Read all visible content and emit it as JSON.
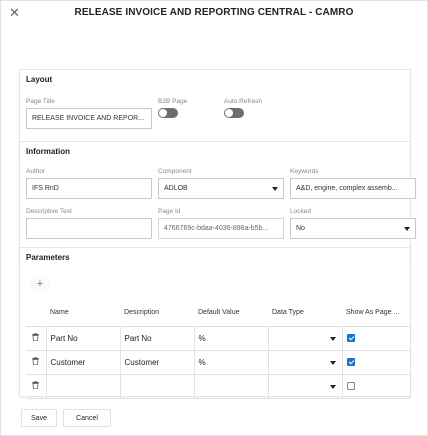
{
  "dialog": {
    "title": "RELEASE INVOICE AND REPORTING CENTRAL - CAMRO",
    "close_icon": "close-icon"
  },
  "layout": {
    "section_title": "Layout",
    "page_title_label": "Page Title",
    "page_title_value": "RELEASE INVOICE AND REPOR...",
    "b2b_label": "B2B Page",
    "b2b_on": false,
    "auto_refresh_label": "Auto Refresh",
    "auto_refresh_on": false
  },
  "information": {
    "section_title": "Information",
    "author_label": "Author",
    "author_value": "IFS RnD",
    "component_label": "Component",
    "component_value": "ADLOB",
    "keywords_label": "Keywords",
    "keywords_value": "A&D, engine, complex assemb...",
    "descriptive_label": "Descriptive Text",
    "descriptive_value": "",
    "page_id_label": "Page Id",
    "page_id_value": "4766769c-bdaa-4036-898a-b5b...",
    "locked_label": "Locked",
    "locked_value": "No"
  },
  "parameters": {
    "section_title": "Parameters",
    "add_icon": "plus-icon",
    "columns": [
      "Name",
      "Description",
      "Default Value",
      "Data Type",
      "Show As Page ..."
    ],
    "rows": [
      {
        "name": "Part No",
        "description": "Part No",
        "default_value": "%",
        "data_type": "",
        "show_as_page": true
      },
      {
        "name": "Customer",
        "description": "Customer",
        "default_value": "%",
        "data_type": "",
        "show_as_page": true
      },
      {
        "name": "",
        "description": "",
        "default_value": "",
        "data_type": "",
        "show_as_page": false
      }
    ]
  },
  "footer": {
    "save_label": "Save",
    "cancel_label": "Cancel"
  },
  "colors": {
    "accent": "#1a73c9",
    "toggle_off": "#6e6e6e"
  }
}
